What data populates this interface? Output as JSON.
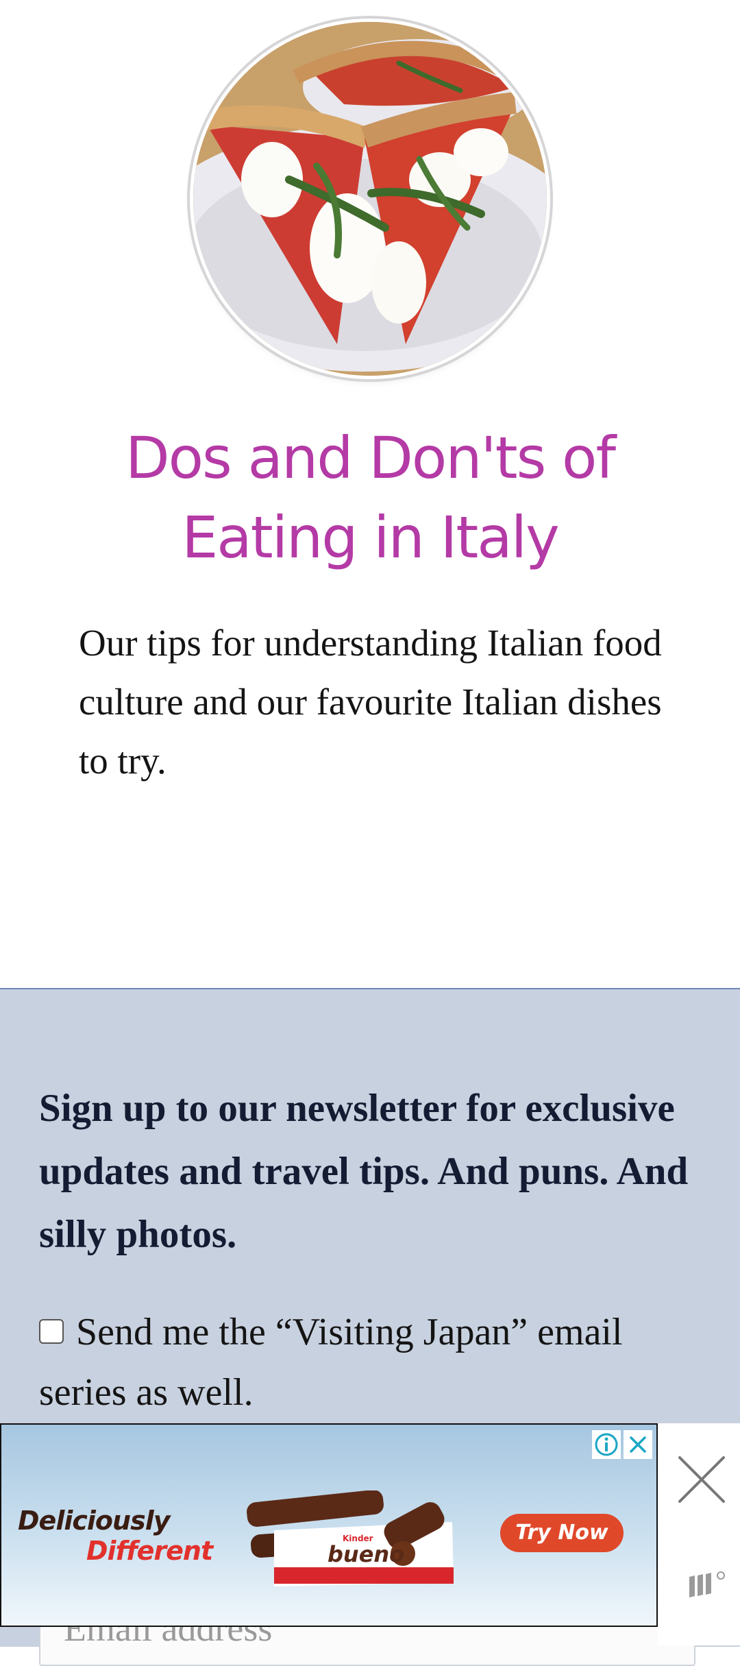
{
  "hero": {
    "image_alt": "Pizza slices with burrata and rocket on a white plate"
  },
  "article": {
    "title": "Dos and Don'ts of Eating in Italy",
    "excerpt": "Our tips for understanding Italian food culture and our favourite Italian dishes to try."
  },
  "newsletter": {
    "heading": "Sign up to our newsletter for exclusive updates and travel tips. And puns. And silly photos.",
    "optin_label": "Send me the “Visiting Japan” email series as well.",
    "optin_checked": false,
    "email_placeholder": "Email address"
  },
  "ad": {
    "slogan_line1": "Deliciously",
    "slogan_line2": "Different",
    "product_brand": "Kinder",
    "product_name": "bueno",
    "cta_label": "Try Now",
    "info_icon": "info-icon",
    "close_icon": "close-icon",
    "accent_color": "#e0482a"
  },
  "colors": {
    "title": "#b43aa6",
    "newsletter_bg": "#c8d1df",
    "newsletter_border": "#6f86b5"
  }
}
